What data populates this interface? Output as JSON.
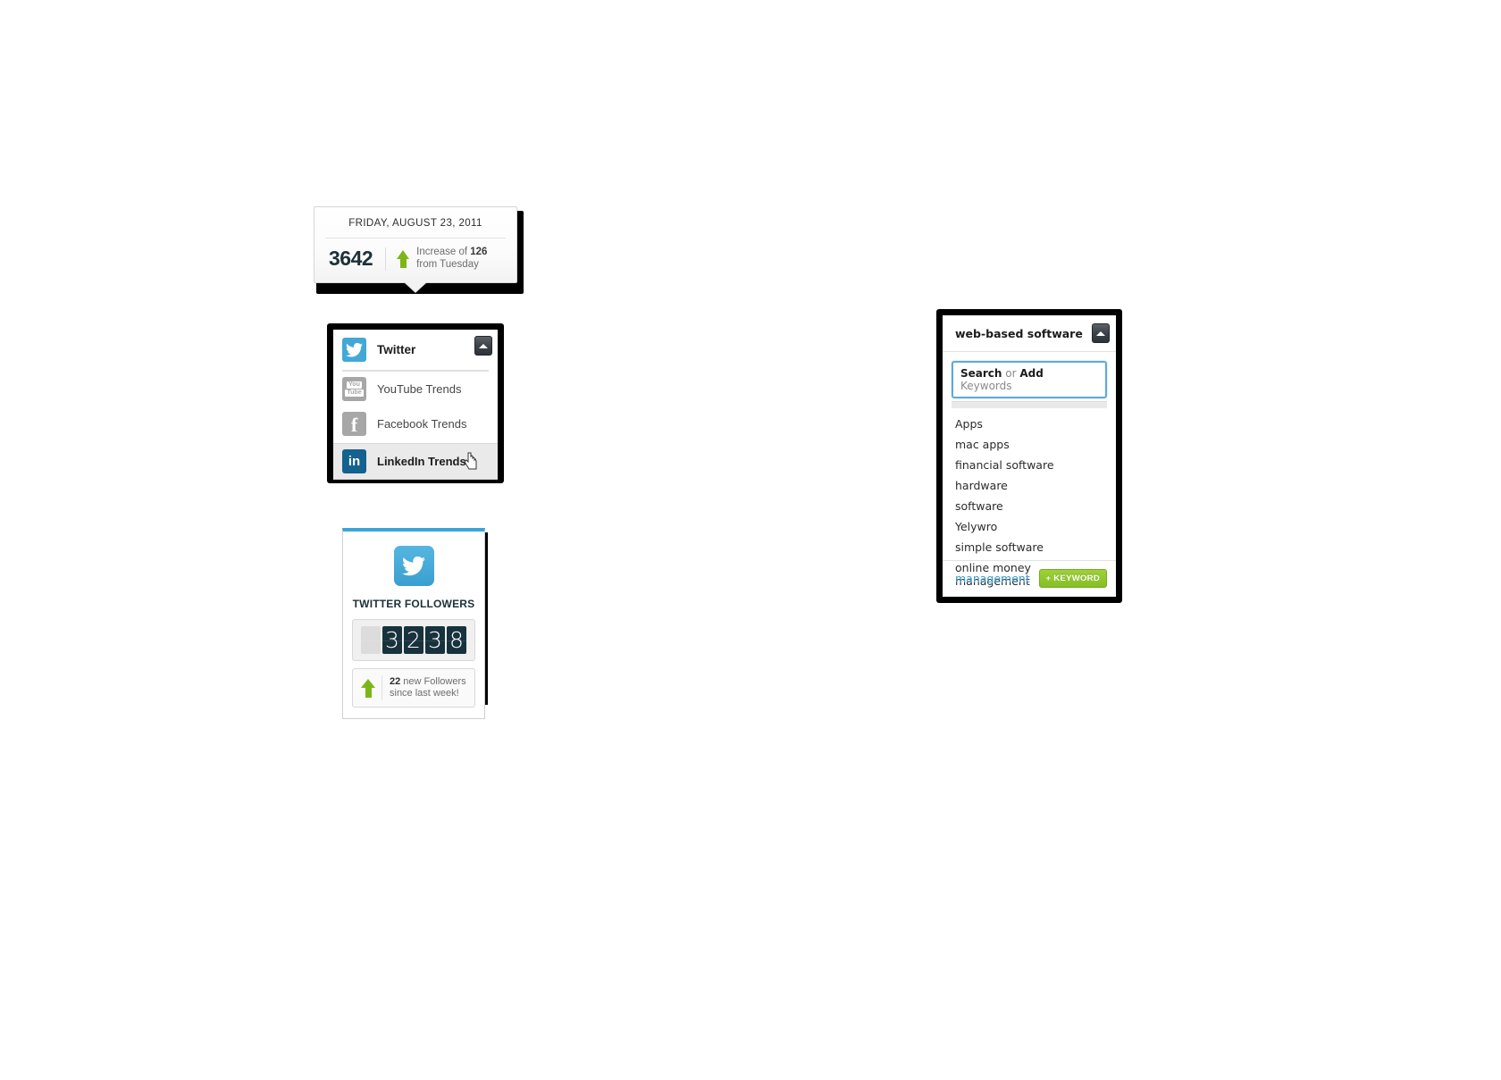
{
  "date_tooltip": {
    "date_label": "FRIDAY, AUGUST 23, 2011",
    "count": "3642",
    "increase_prefix": "Increase of ",
    "increase_value": "126",
    "increase_suffix": "from Tuesday",
    "arrow_icon": "arrow-up-icon",
    "accent_color": "#7cb518"
  },
  "twitter_dropdown": {
    "header": {
      "label": "Twitter",
      "icon": "twitter-bird-icon",
      "icon_color": "#43a8d5",
      "collapse_icon": "caret-up-icon"
    },
    "items": [
      {
        "label": "YouTube Trends",
        "icon": "youtube-icon",
        "icon_color": "#a7a7a7",
        "selected": false
      },
      {
        "label": "Facebook Trends",
        "icon": "facebook-icon",
        "icon_color": "#a7a7a7",
        "selected": false
      },
      {
        "label": "LinkedIn Trends",
        "icon": "linkedin-icon",
        "icon_color": "#15618f",
        "selected": true
      }
    ],
    "cursor": "hand-pointer-cursor"
  },
  "followers_widget": {
    "logo_icon": "twitter-bird-icon",
    "accent_color": "#3aa5d8",
    "title": "TWITTER FOLLOWERS",
    "counter_digits": [
      "",
      "3",
      "2",
      "3",
      "8"
    ],
    "counter_value": "3238",
    "arrow_icon": "arrow-up-icon",
    "stat_value": "22",
    "stat_text_line1": " new Followers",
    "stat_text_line2": "since last week!"
  },
  "keyword_panel": {
    "header": {
      "title": "web-based software",
      "collapse_icon": "caret-up-icon"
    },
    "search": {
      "prefix_bold": "Search",
      "middle": " or ",
      "second_bold": "Add",
      "suffix": " Keywords",
      "placeholder": "Search or Add Keywords",
      "value": "",
      "border_color": "#5fa9d8"
    },
    "keywords": [
      "Apps",
      "mac apps",
      "financial software",
      "hardware",
      "software",
      "Yelywro",
      "simple software",
      "online money management"
    ],
    "footer": {
      "link_label": "management",
      "link_color": "#3a9fd0",
      "add_button_label": "+ KEYWORD",
      "add_button_color": "#8fc82e"
    }
  }
}
